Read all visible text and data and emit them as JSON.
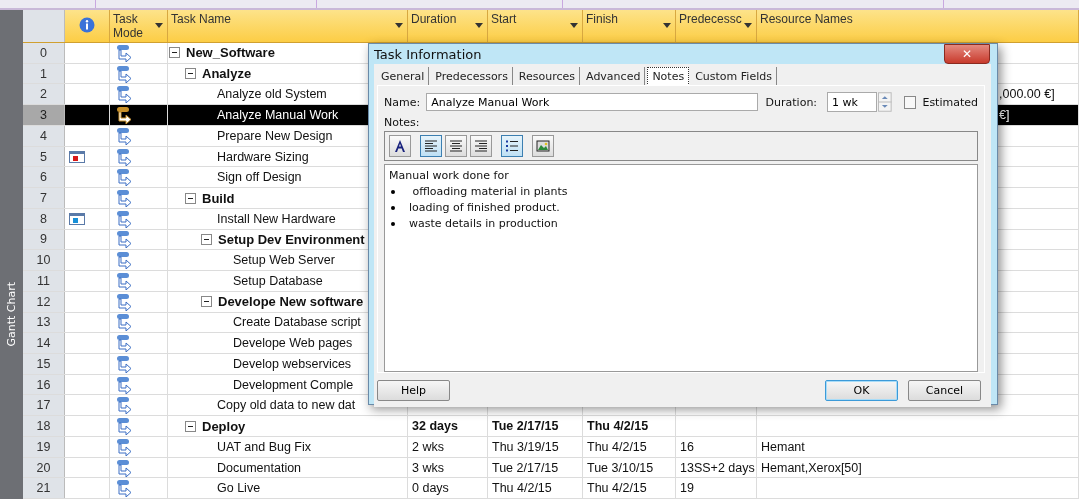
{
  "side_label": "Gantt Chart",
  "columns": [
    {
      "kind": "info",
      "dropdown": false
    },
    {
      "label": "Task Mode",
      "kind": "text",
      "dropdown": true
    },
    {
      "label": "Task Name",
      "kind": "text",
      "dropdown": true
    },
    {
      "label": "Duration",
      "kind": "text",
      "dropdown": true
    },
    {
      "label": "Start",
      "kind": "text",
      "dropdown": true
    },
    {
      "label": "Finish",
      "kind": "text",
      "dropdown": true
    },
    {
      "label": "Predecessc",
      "kind": "text",
      "dropdown": true
    },
    {
      "label": "Resource Names",
      "kind": "text",
      "dropdown": false
    }
  ],
  "tasks": [
    {
      "id": "0",
      "name": "New_Software",
      "expanded": true,
      "selected": false,
      "children": [
        {
          "id": "1",
          "name": "Analyze",
          "expanded": true,
          "selected": false,
          "children": [
            {
              "id": "2",
              "name": "Analyze old System",
              "selected": false,
              "resources": ",000.00 €]"
            },
            {
              "id": "3",
              "name": "Analyze Manual Work",
              "selected": true,
              "resources": "€]"
            },
            {
              "id": "4",
              "name": "Prepare New Design",
              "selected": false
            },
            {
              "id": "5",
              "name": "Hardware Sizing",
              "selected": false,
              "indicator": {
                "color": "#d81818"
              }
            },
            {
              "id": "6",
              "name": "Sign off Design",
              "selected": false
            }
          ]
        },
        {
          "id": "7",
          "name": "Build",
          "expanded": true,
          "selected": false,
          "children": [
            {
              "id": "8",
              "name": "Install New Hardware",
              "selected": false,
              "indicator": {
                "color": "#1890d8"
              }
            },
            {
              "id": "9",
              "name": "Setup Dev Environment",
              "expanded": true,
              "selected": false,
              "children": [
                {
                  "id": "10",
                  "name": "Setup Web Server",
                  "selected": false
                },
                {
                  "id": "11",
                  "name": "Setup Database",
                  "selected": false
                }
              ]
            },
            {
              "id": "12",
              "name": "Develope New software",
              "expanded": true,
              "selected": false,
              "children": [
                {
                  "id": "13",
                  "name": "Create Database script",
                  "selected": false
                },
                {
                  "id": "14",
                  "name": "Develope Web pages",
                  "selected": false
                },
                {
                  "id": "15",
                  "name": "Develop webservices",
                  "selected": false
                },
                {
                  "id": "16",
                  "name": "Development Comple",
                  "selected": false
                }
              ]
            },
            {
              "id": "17",
              "name": "Copy old data to new dat",
              "selected": false
            }
          ]
        },
        {
          "id": "18",
          "name": "Deploy",
          "expanded": true,
          "selected": false,
          "duration": "32 days",
          "start": "Tue 2/17/15",
          "finish": "Thu 4/2/15",
          "children": [
            {
              "id": "19",
              "name": "UAT and Bug Fix",
              "selected": false,
              "duration": "2 wks",
              "start": "Thu 3/19/15",
              "finish": "Thu 4/2/15",
              "predecessors": "16",
              "resources": "Hemant"
            },
            {
              "id": "20",
              "name": "Documentation",
              "selected": false,
              "duration": "3 wks",
              "start": "Tue 2/17/15",
              "finish": "Tue 3/10/15",
              "predecessors": "13SS+2 days",
              "resources": "Hemant,Xerox[50]"
            },
            {
              "id": "21",
              "name": "Go Live",
              "selected": false,
              "duration": "0 days",
              "start": "Thu 4/2/15",
              "finish": "Thu 4/2/15",
              "predecessors": "19"
            }
          ]
        }
      ]
    }
  ],
  "dialog": {
    "title": "Task Information",
    "close": "✕",
    "tabs": [
      {
        "label": "General",
        "selected": false
      },
      {
        "label": "Predecessors",
        "selected": false
      },
      {
        "label": "Resources",
        "selected": false
      },
      {
        "label": "Advanced",
        "selected": false
      },
      {
        "label": "Notes",
        "selected": true
      },
      {
        "label": "Custom Fields",
        "selected": false
      }
    ],
    "name_label": "Name:",
    "name_value": "Analyze Manual Work",
    "duration_label": "Duration:",
    "duration_value": "1 wk",
    "estimated": {
      "label": "Estimated",
      "checked": false
    },
    "notes_label": "Notes:",
    "toolbar": [
      {
        "kind": "font",
        "selected": false
      },
      {
        "kind": "align-left",
        "selected": true
      },
      {
        "kind": "align-center",
        "selected": false
      },
      {
        "kind": "align-right",
        "selected": false
      },
      {
        "kind": "bullets",
        "selected": true
      },
      {
        "kind": "object",
        "selected": false
      }
    ],
    "notes_intro": "Manual work done for",
    "notes_bullets": [
      " offloading material in plants",
      "loading of finished product.",
      "waste details in production"
    ],
    "buttons": [
      {
        "label": "Help",
        "default": false
      },
      {
        "label": "OK",
        "default": true
      },
      {
        "label": "Cancel",
        "default": false
      }
    ]
  }
}
